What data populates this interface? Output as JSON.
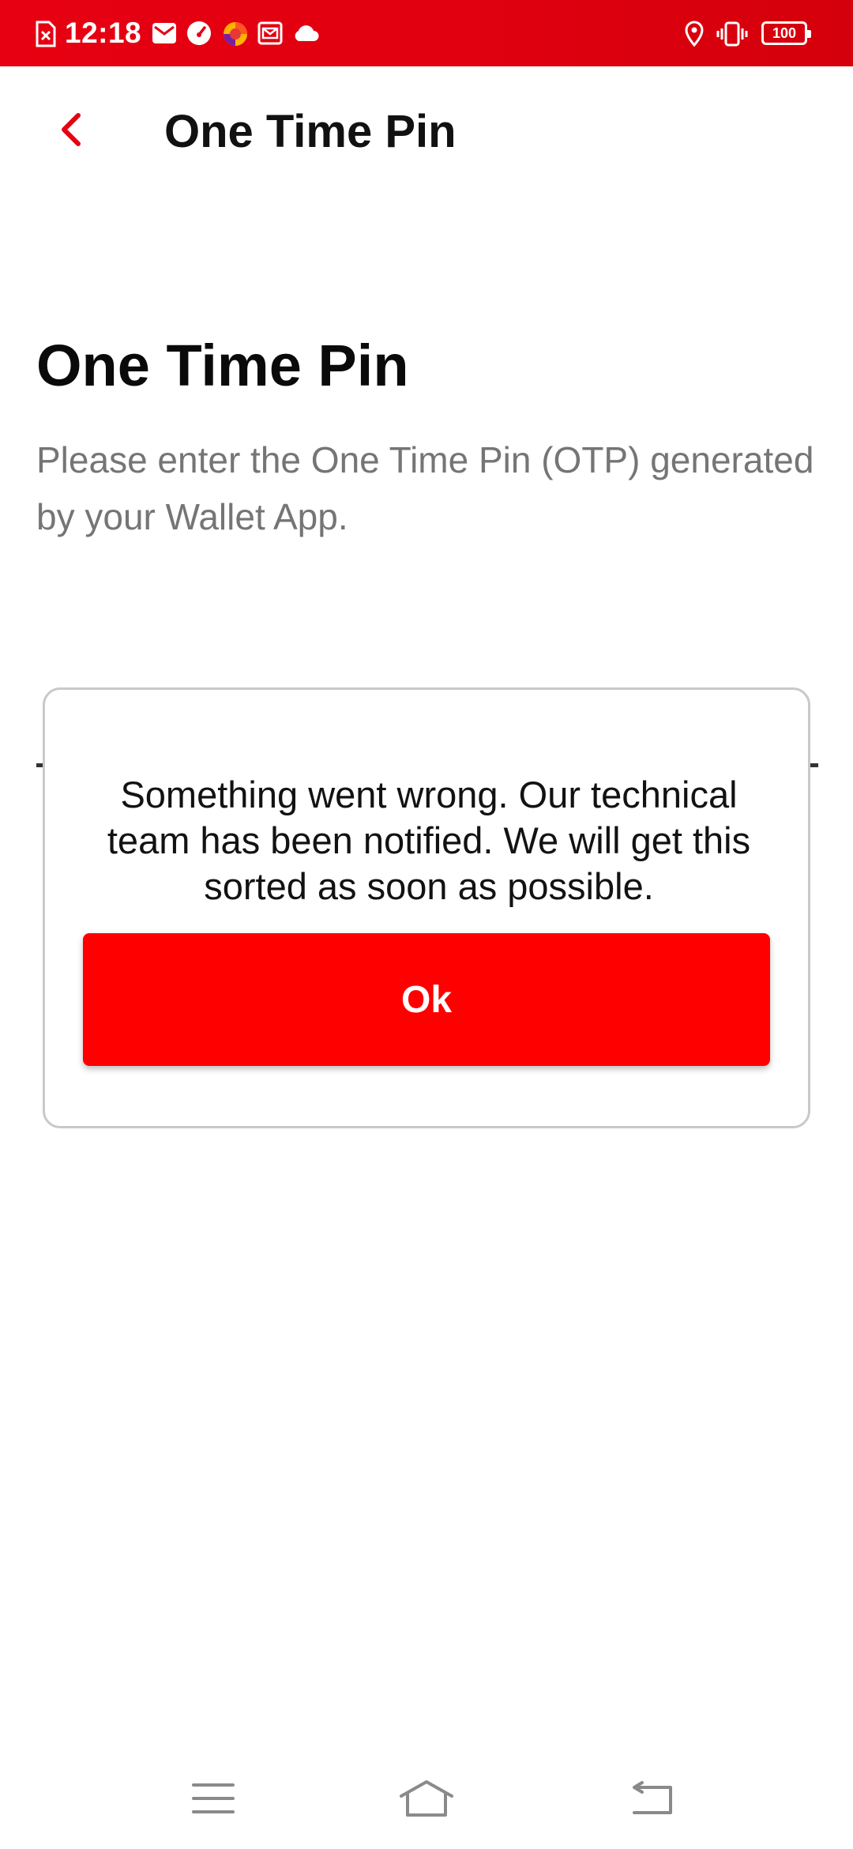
{
  "status_bar": {
    "time": "12:18",
    "battery": "100",
    "background_color": "#e60012",
    "icons": [
      "sim-error-icon",
      "mail-icon",
      "speedometer-icon",
      "browser-icon",
      "email-icon",
      "cloud-icon",
      "location-icon",
      "vibrate-icon",
      "battery-icon"
    ]
  },
  "header": {
    "back_icon": "chevron-left-icon",
    "title": "One Time Pin",
    "accent_color": "#e60012"
  },
  "main": {
    "heading": "One Time Pin",
    "description": "Please enter the One Time Pin (OTP) generated by your Wallet App."
  },
  "dialog": {
    "message": "Something went wrong. Our technical team has been notified. We will get this sorted as soon as possible.",
    "ok_label": "Ok",
    "button_color": "#ff0000"
  },
  "nav_bar": {
    "icons": [
      "menu-icon",
      "home-icon",
      "back-icon"
    ]
  }
}
